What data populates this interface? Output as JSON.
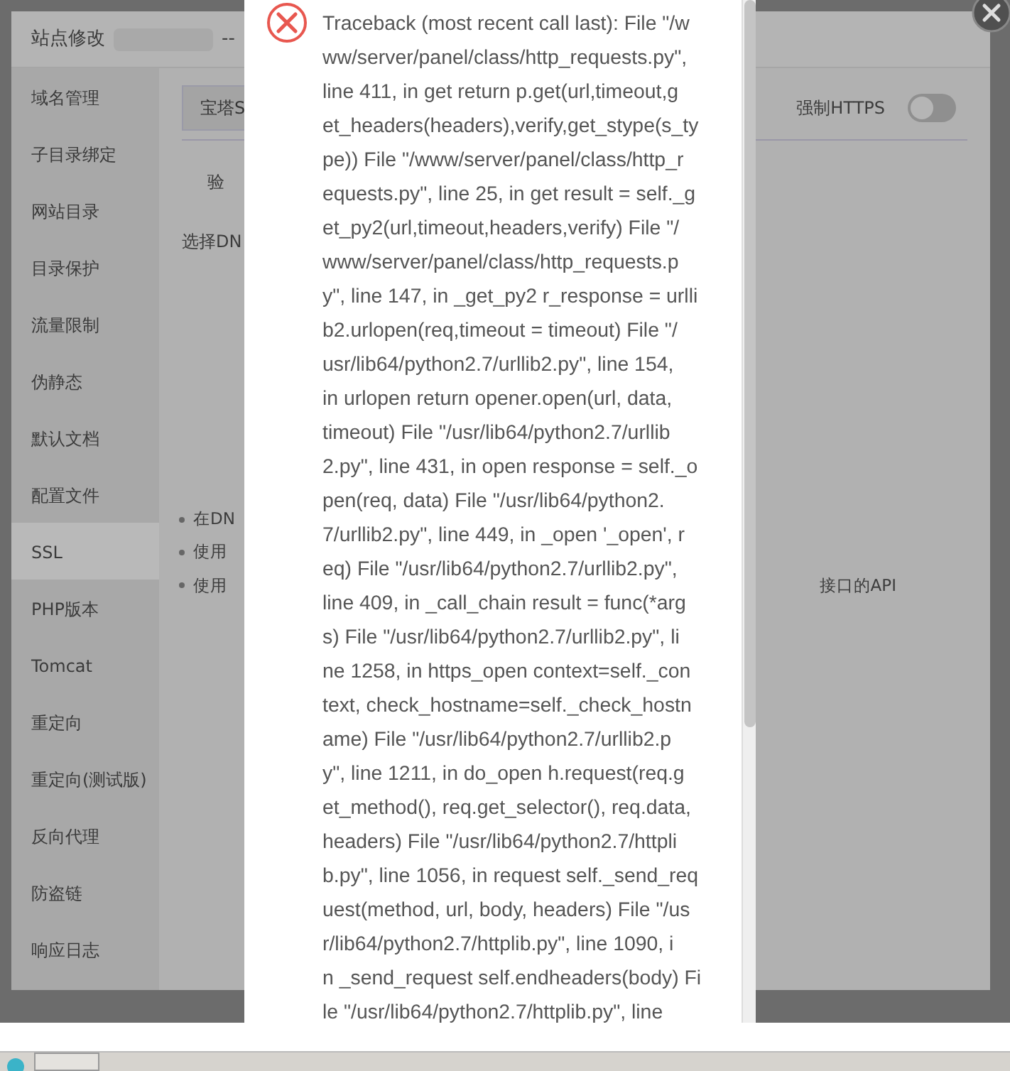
{
  "dialog": {
    "title": "站点修改",
    "title_suffix": "-- "
  },
  "sidebar": {
    "items": [
      {
        "label": "域名管理",
        "selected": false
      },
      {
        "label": "子目录绑定",
        "selected": false
      },
      {
        "label": "网站目录",
        "selected": false
      },
      {
        "label": "目录保护",
        "selected": false
      },
      {
        "label": "流量限制",
        "selected": false
      },
      {
        "label": "伪静态",
        "selected": false
      },
      {
        "label": "默认文档",
        "selected": false
      },
      {
        "label": "配置文件",
        "selected": false
      },
      {
        "label": "SSL",
        "selected": true
      },
      {
        "label": "PHP版本",
        "selected": false
      },
      {
        "label": "Tomcat",
        "selected": false
      },
      {
        "label": "重定向",
        "selected": false
      },
      {
        "label": "重定向(测试版)",
        "selected": false
      },
      {
        "label": "反向代理",
        "selected": false
      },
      {
        "label": "防盗链",
        "selected": false
      },
      {
        "label": "响应日志",
        "selected": false
      }
    ]
  },
  "content": {
    "tab_button": "宝塔S",
    "verify_label": "验",
    "dns_label": "选择DN",
    "force_https": {
      "label": "强制HTTPS",
      "on": false
    },
    "notes": [
      "在DN",
      "使用",
      "使用"
    ],
    "note_tail": "接口的API"
  },
  "error_popup": {
    "message_lines": [
      "Traceback (most recent call last): File \"/w",
      "ww/server/panel/class/http_requests.py\",",
      "line 411, in get return p.get(url,timeout,g",
      "et_headers(headers),verify,get_stype(s_ty",
      "pe)) File \"/www/server/panel/class/http_r",
      "equests.py\", line 25, in get result = self._g",
      "et_py2(url,timeout,headers,verify) File \"/",
      "www/server/panel/class/http_requests.p",
      "y\", line 147, in _get_py2 r_response = urlli",
      "b2.urlopen(req,timeout = timeout) File \"/",
      "usr/lib64/python2.7/urllib2.py\", line 154,",
      "in urlopen return opener.open(url, data,",
      "timeout) File \"/usr/lib64/python2.7/urllib",
      "2.py\", line 431, in open response = self._o",
      "pen(req, data) File \"/usr/lib64/python2.",
      "7/urllib2.py\", line 449, in _open '_open', r",
      "eq) File \"/usr/lib64/python2.7/urllib2.py\",",
      "line 409, in _call_chain result = func(*arg",
      "s) File \"/usr/lib64/python2.7/urllib2.py\", li",
      "ne 1258, in https_open context=self._con",
      "text, check_hostname=self._check_hostn",
      "ame) File \"/usr/lib64/python2.7/urllib2.p",
      "y\", line 1211, in do_open h.request(req.g",
      "et_method(), req.get_selector(), req.data,",
      "headers) File \"/usr/lib64/python2.7/httpli",
      "b.py\", line 1056, in request self._send_req",
      "uest(method, url, body, headers) File \"/us",
      "r/lib64/python2.7/httplib.py\", line 1090, i",
      "n _send_request self.endheaders(body) Fi",
      "le \"/usr/lib64/python2.7/httplib.py\", line"
    ]
  }
}
